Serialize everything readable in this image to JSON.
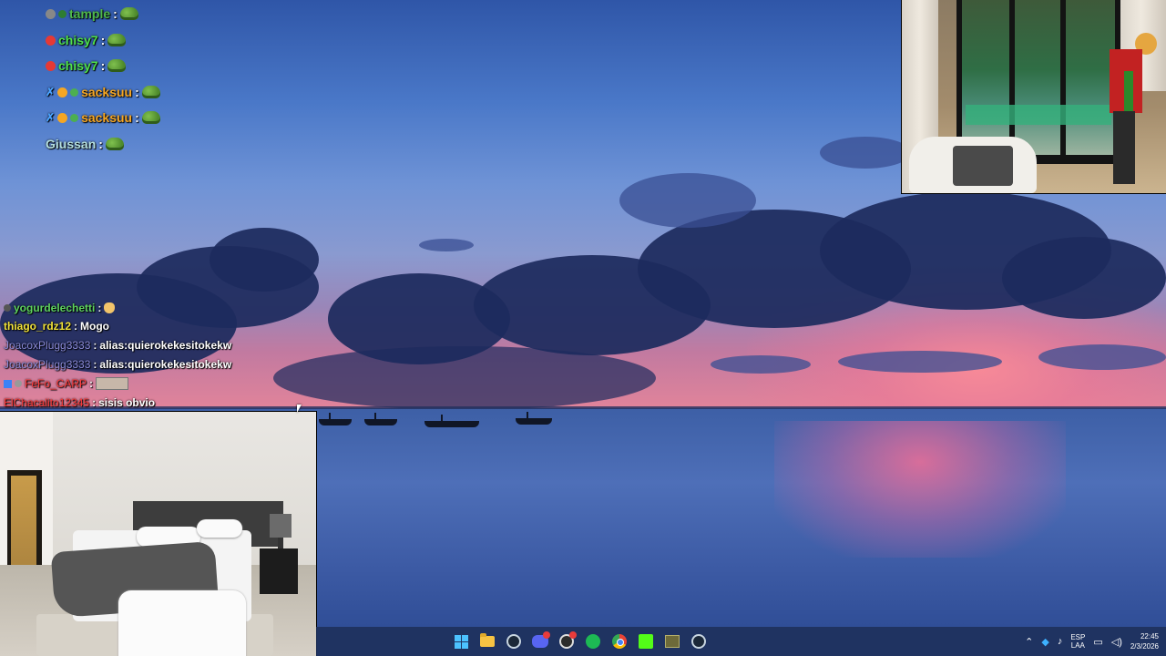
{
  "chat_top": [
    {
      "user": "tample",
      "color": "#4fb84b",
      "text": "",
      "emote": "pepe-emote"
    },
    {
      "user": "chisy7",
      "color": "#4fe14b",
      "text": "",
      "emote": "pepe-emote"
    },
    {
      "user": "chisy7",
      "color": "#4fe14b",
      "text": "",
      "emote": "pepe-emote"
    },
    {
      "user": "sacksuu",
      "color": "#f5a623",
      "text": "",
      "emote": "pepe-emote"
    },
    {
      "user": "sacksuu",
      "color": "#f5a623",
      "text": "",
      "emote": "pepe-emote"
    },
    {
      "user": "Giussan",
      "color": "#b5e0e0",
      "text": "",
      "emote": "pepe-emote"
    }
  ],
  "chat_bottom": [
    {
      "user": "yogurdelechetti",
      "color": "#5fd45f",
      "text": ""
    },
    {
      "user": "thiago_rdz12",
      "color": "#f1e23a",
      "text": "Mogo"
    },
    {
      "user": "JoacoxPlugg3333",
      "color": "#8a8ad8",
      "text": "alias:quierokekesitokekw"
    },
    {
      "user": "JoacoxPlugg3333",
      "color": "#8a8ad8",
      "text": "alias:quierokekesitokekw"
    },
    {
      "user": "FeFo_CARP",
      "color": "#ff3b3b",
      "text": ""
    },
    {
      "user": "ElChacalito12345",
      "color": "#ff3b3b",
      "text": "sisis obvio"
    }
  ],
  "taskbar": {
    "apps": [
      "start-icon",
      "file-explorer-icon",
      "steam-icon",
      "discord-icon",
      "obs-icon",
      "spotify-icon",
      "chrome-icon",
      "kick-icon",
      "app-icon",
      "steam-icon"
    ],
    "lang": "ESP",
    "layout": "LAA",
    "time": "22:45",
    "date": "2/3/2026"
  }
}
